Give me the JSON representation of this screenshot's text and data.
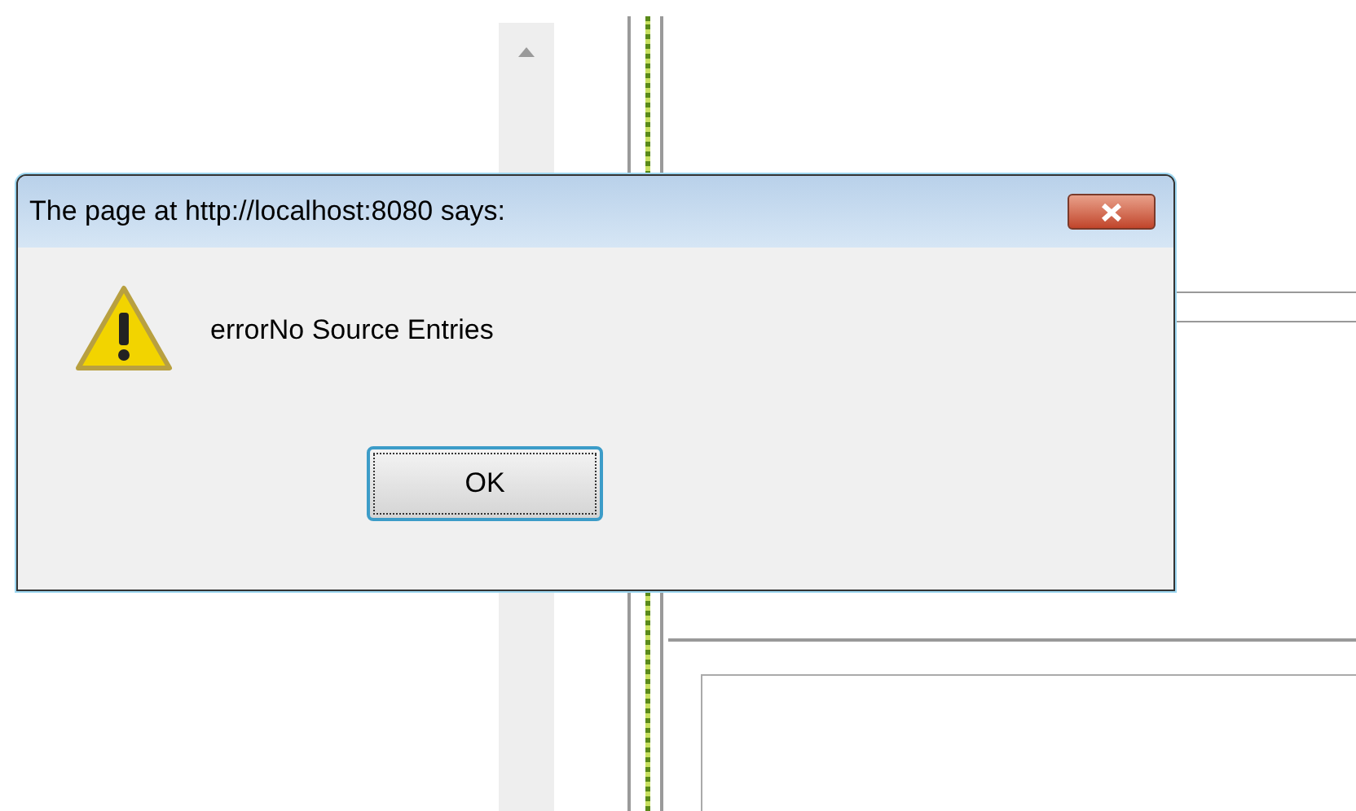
{
  "dialog": {
    "title": "The page at http://localhost:8080 says:",
    "message": "errorNo Source Entries",
    "buttons": [
      {
        "label": "OK"
      }
    ]
  }
}
